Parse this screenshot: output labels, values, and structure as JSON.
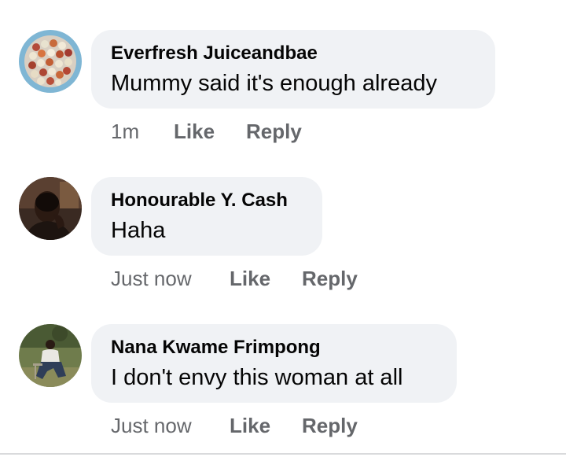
{
  "comments": [
    {
      "author": "Everfresh Juiceandbae",
      "text": "Mummy said it's enough already",
      "time": "1m",
      "like_label": "Like",
      "reply_label": "Reply"
    },
    {
      "author": "Honourable Y. Cash",
      "text": "Haha",
      "time": "Just now",
      "like_label": "Like",
      "reply_label": "Reply"
    },
    {
      "author": "Nana Kwame Frimpong",
      "text": "I don't envy this woman at all",
      "time": "Just now",
      "like_label": "Like",
      "reply_label": "Reply"
    }
  ],
  "colors": {
    "bubble_bg": "#f0f2f5",
    "primary_text": "#050505",
    "secondary_text": "#65676b"
  }
}
